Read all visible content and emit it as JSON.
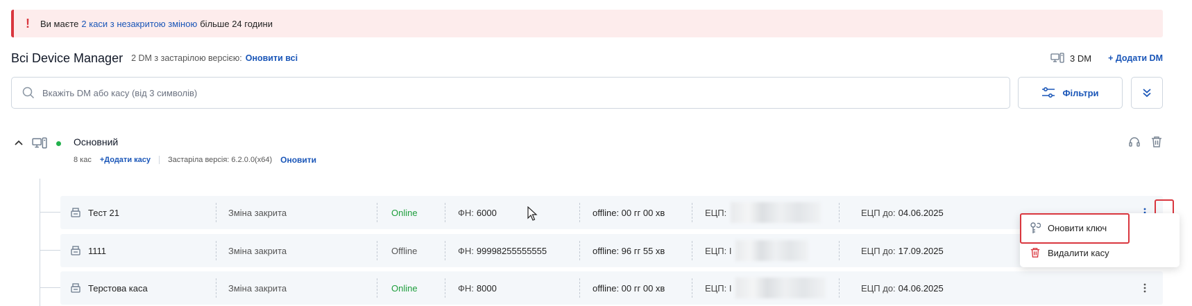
{
  "alert": {
    "prefix": "Ви маєте",
    "link": "2 каси з незакритою зміною",
    "suffix": "більше 24 години"
  },
  "header": {
    "title": "Всі Device Manager",
    "outdated_text": "2 DM з застарілою версією:",
    "update_all": "Оновити всі",
    "dm_count": "3 DM",
    "add_dm": "+ Додати DM"
  },
  "search": {
    "placeholder": "Вкажіть DM або касу (від 3 символів)"
  },
  "filters": {
    "label": "Фільтри"
  },
  "group": {
    "name": "Основний",
    "count": "8 кас",
    "add_cash": "+Додати касу",
    "outdated_version": "Застаріла версія: 6.2.0.0(x64)",
    "update": "Оновити"
  },
  "rows": [
    {
      "name": "Тест 21",
      "shift": "Зміна закрита",
      "status": "Online",
      "fn_label": "ФН:",
      "fn": "6000",
      "offline": "offline: 00 гг 00 хв",
      "ecp_label": "ЕЦП:",
      "ecp_until_label": "ЕЦП до:",
      "ecp_until": "04.06.2025"
    },
    {
      "name": "1111",
      "shift": "Зміна закрита",
      "status": "Offline",
      "fn_label": "ФН:",
      "fn": "99998255555555",
      "offline": "offline: 96 гг 55 хв",
      "ecp_label": "ЕЦП: I",
      "ecp_until_label": "ЕЦП до:",
      "ecp_until": "17.09.2025"
    },
    {
      "name": "Терстова каса",
      "shift": "Зміна закрита",
      "status": "Online",
      "fn_label": "ФН:",
      "fn": "8000",
      "offline": "offline: 00 гг 00 хв",
      "ecp_label": "ЕЦП: I",
      "ecp_until_label": "ЕЦП до:",
      "ecp_until": "04.06.2025"
    }
  ],
  "context_menu": {
    "update_key": "Оновити ключ",
    "delete_cash": "Видалити касу"
  },
  "colors": {
    "accent": "#1a56b8",
    "danger": "#d9363e",
    "online": "#1e9e3c",
    "alert_bg": "#fdecec"
  }
}
